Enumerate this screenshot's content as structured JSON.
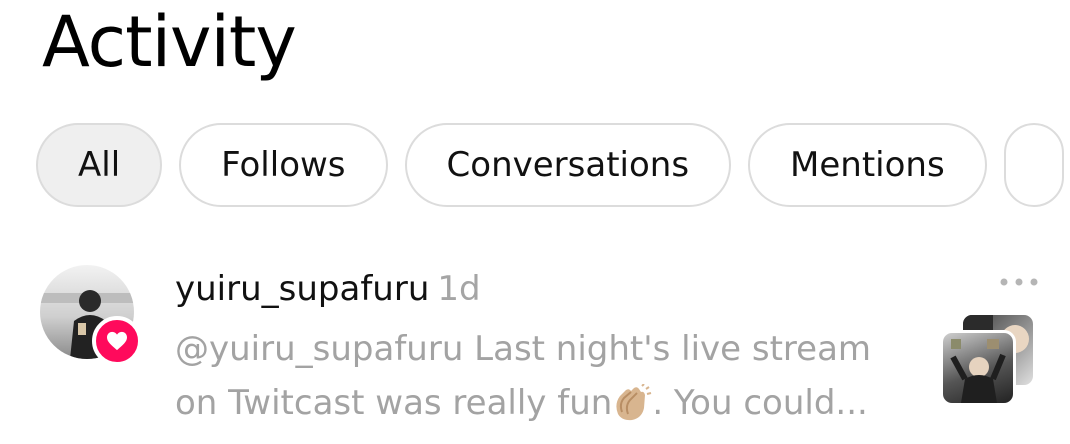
{
  "header": {
    "title": "Activity"
  },
  "tabs": [
    {
      "label": "All",
      "active": true
    },
    {
      "label": "Follows",
      "active": false
    },
    {
      "label": "Conversations",
      "active": false
    },
    {
      "label": "Mentions",
      "active": false
    }
  ],
  "activity": {
    "username": "yuiru_supafuru",
    "time": "1d",
    "message_line1": "@yuiru_supafuru Last night's live stream",
    "message_line2_before": "on Twitcast was really fun",
    "message_line2_after": ". You could...",
    "emoji": "clapping-hands",
    "badge_icon": "heart-icon",
    "badge_color": "#ff0a5c"
  }
}
